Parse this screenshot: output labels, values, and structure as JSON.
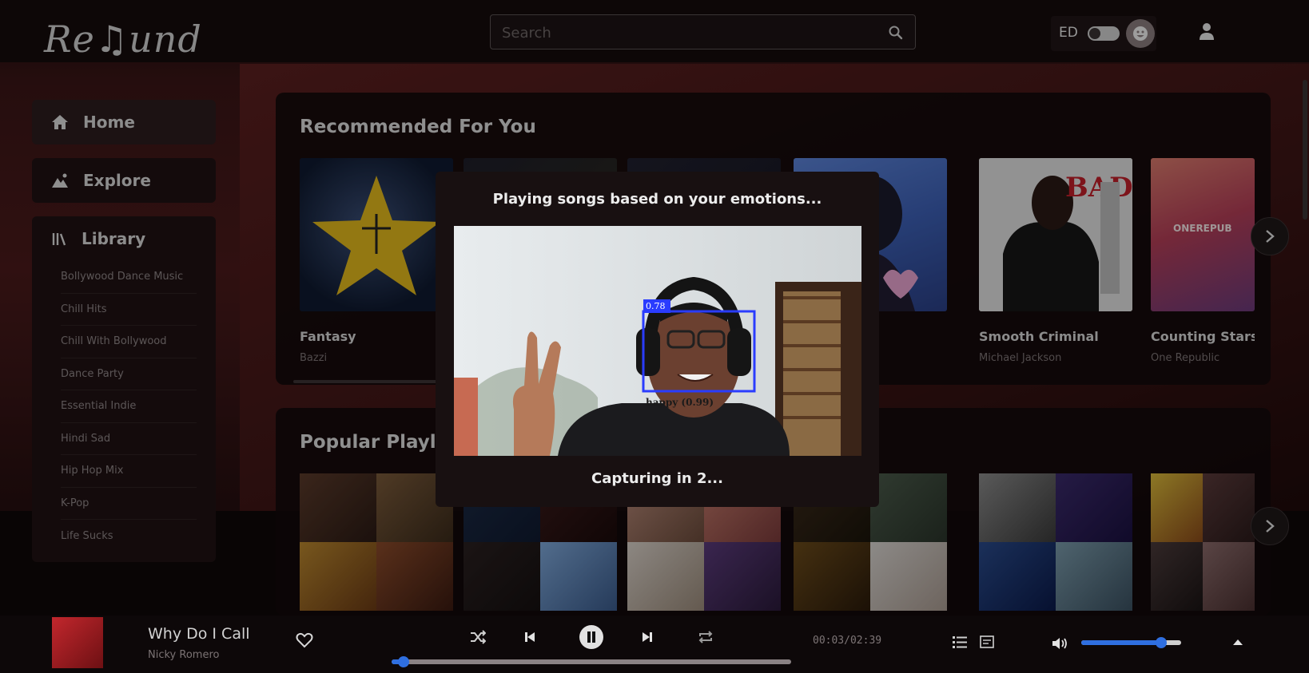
{
  "app": {
    "logo": "Re♫und"
  },
  "header": {
    "search_placeholder": "Search",
    "ed_label": "ED"
  },
  "sidebar": {
    "nav": [
      {
        "label": "Home",
        "icon": "home-icon"
      },
      {
        "label": "Explore",
        "icon": "explore-icon"
      }
    ],
    "library": {
      "label": "Library",
      "icon": "library-icon",
      "playlists": [
        "Bollywood Dance Music",
        "Chill Hits",
        "Chill With Bollywood",
        "Dance Party",
        "Essential Indie",
        "Hindi Sad",
        "Hip Hop Mix",
        "K-Pop",
        "Life Sucks"
      ]
    }
  },
  "recommended": {
    "title": "Recommended For You",
    "cards": [
      {
        "title": "Fantasy",
        "subtitle": "Bazzi",
        "color": "#1b2a44"
      },
      {
        "title": "",
        "subtitle": "",
        "color": "#1a1a2a"
      },
      {
        "title": "",
        "subtitle": "",
        "color": "#222230"
      },
      {
        "title": "",
        "subtitle": "",
        "color": "#3a5fb0"
      },
      {
        "title": "Smooth Criminal",
        "subtitle": "Michael Jackson",
        "color": "#d8d8d8"
      },
      {
        "title": "Counting Stars",
        "subtitle": "One Republic",
        "color": "#b04055"
      }
    ]
  },
  "popular": {
    "title": "Popular Playli"
  },
  "modal": {
    "title": "Playing songs based on your emotions...",
    "detection_confidence": "0.78",
    "detection_label": "happy (0.99)",
    "countdown": "Capturing in 2..."
  },
  "player": {
    "track_title": "Why Do I Call",
    "track_artist": "Nicky Romero",
    "time": "00:03/02:39",
    "progress": 0.03,
    "volume": 0.8
  },
  "colors": {
    "accent": "#2f6fe0",
    "detection_box": "#2a3cff"
  }
}
